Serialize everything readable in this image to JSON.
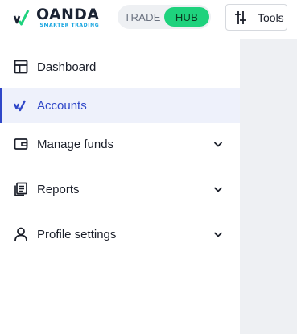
{
  "header": {
    "logo": {
      "name": "OANDA",
      "tagline": "SMARTER TRADING"
    },
    "switcher": {
      "trade_label": "TRADE",
      "hub_label": "HUB",
      "active": "HUB"
    },
    "tools_label": "Tools"
  },
  "sidebar": {
    "items": [
      {
        "label": "Dashboard",
        "icon": "dashboard-icon",
        "expandable": false,
        "active": false
      },
      {
        "label": "Accounts",
        "icon": "oanda-accounts-icon",
        "expandable": false,
        "active": true
      },
      {
        "label": "Manage funds",
        "icon": "wallet-icon",
        "expandable": true,
        "active": false
      },
      {
        "label": "Reports",
        "icon": "reports-icon",
        "expandable": true,
        "active": false
      },
      {
        "label": "Profile settings",
        "icon": "user-icon",
        "expandable": true,
        "active": false
      }
    ]
  },
  "colors": {
    "accent": "#2f47c8",
    "hub_green": "#1ed27d",
    "active_bg": "#eef1fb",
    "content_bg": "#eef0f3",
    "tagline_blue": "#1aa6e0"
  }
}
